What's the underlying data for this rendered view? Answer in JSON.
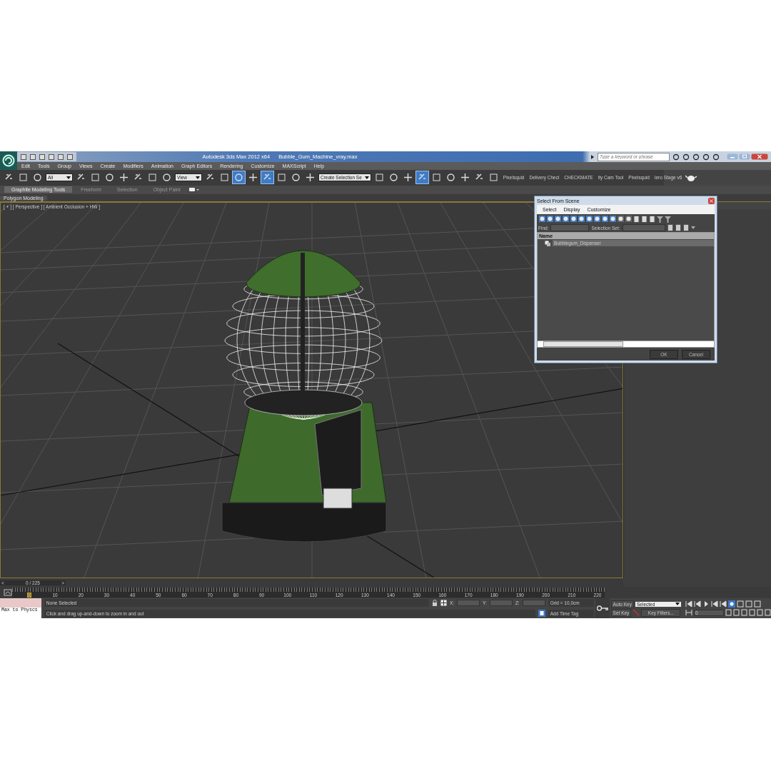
{
  "title_bar": {
    "app": "Autodesk 3ds Max  2012 x64",
    "file": "Bubble_Gum_Machine_vray.max",
    "search": {
      "placeholder": "Type a keyword or phrase"
    }
  },
  "menu": [
    "Edit",
    "Tools",
    "Group",
    "Views",
    "Create",
    "Modifiers",
    "Animation",
    "Graph Editors",
    "Rendering",
    "Customize",
    "MAXScript",
    "Help"
  ],
  "toolbar": {
    "tools": [
      {
        "selected": false
      },
      {
        "selected": false
      },
      {
        "selected": false
      },
      {
        "kind": "dropdown",
        "value": "All"
      },
      {
        "selected": false
      },
      {
        "selected": false
      },
      {
        "selected": false
      },
      {
        "selected": false
      },
      {
        "selected": false
      },
      {
        "selected": false
      },
      {
        "selected": false
      },
      {
        "kind": "dropdown",
        "value": "View"
      },
      {
        "selected": false
      },
      {
        "selected": false
      },
      {
        "selected": true
      },
      {
        "selected": false
      },
      {
        "selected": true
      },
      {
        "selected": false
      },
      {
        "selected": false
      },
      {
        "selected": false
      },
      {
        "kind": "dropdown",
        "value": "Create Selection Se"
      },
      {
        "selected": false
      },
      {
        "selected": false
      },
      {
        "selected": false
      },
      {
        "selected": true
      },
      {
        "selected": false
      },
      {
        "selected": false
      },
      {
        "selected": false
      },
      {
        "selected": false
      },
      {
        "selected": false
      }
    ],
    "scripts": [
      "Pixelsquid",
      "Delivery Checl",
      "CHECKMATE",
      "ity Cam Tool",
      "Pixelsquid",
      "lero Stage v6"
    ]
  },
  "ribbon": {
    "tabs": [
      {
        "label": "Graphite Modeling Tools",
        "selected": true
      },
      {
        "label": "Freeform",
        "selected": false
      },
      {
        "label": "Selection",
        "selected": false
      },
      {
        "label": "Object Paint",
        "selected": false
      }
    ],
    "panel": "Polygon Modeling"
  },
  "viewport": {
    "label": "[ + ] [ Perspective ] [ Ambient Occlusion + HW ]"
  },
  "dialog": {
    "title": "Select From Scene",
    "menu": [
      "Select",
      "Display",
      "Customize"
    ],
    "filters": [
      {
        "selected": true
      },
      {
        "selected": true
      },
      {
        "selected": true
      },
      {
        "selected": true
      },
      {
        "selected": true
      },
      {
        "selected": true
      },
      {
        "selected": true
      },
      {
        "selected": true
      },
      {
        "selected": true
      },
      {
        "selected": true
      },
      {
        "selected": false
      },
      {
        "selected": false
      }
    ],
    "find_label": "Find:",
    "selection_set_label": "Selection Set:",
    "column": "Name",
    "rows": [
      {
        "name": "Bubblegum_Dispenser",
        "selected": true
      }
    ],
    "buttons": [
      "OK",
      "Cancel"
    ]
  },
  "time_slider": {
    "level": 0,
    "prev": "<",
    "frame": "0 / 225",
    "next": ">"
  },
  "track_bar": {
    "ticks": [
      "0",
      "10",
      "20",
      "30",
      "40",
      "50",
      "60",
      "70",
      "80",
      "90",
      "100",
      "110",
      "120",
      "130",
      "140",
      "150",
      "160",
      "170",
      "180",
      "190",
      "200",
      "210",
      "220"
    ]
  },
  "status": {
    "listener": "Max to Physcs",
    "selection": "None Selected",
    "prompt": "Click and drag up-and-down to zoom in and out",
    "coords": [
      "X:",
      "Y:",
      "Z:"
    ],
    "grid": "Grid = 10,0cm",
    "time_tag": "Add Time Tag",
    "auto_key": "Auto Key",
    "key_mode": "Selected",
    "set_key": "Set Key",
    "key_filters": "Key Filters...",
    "frame": "0"
  }
}
